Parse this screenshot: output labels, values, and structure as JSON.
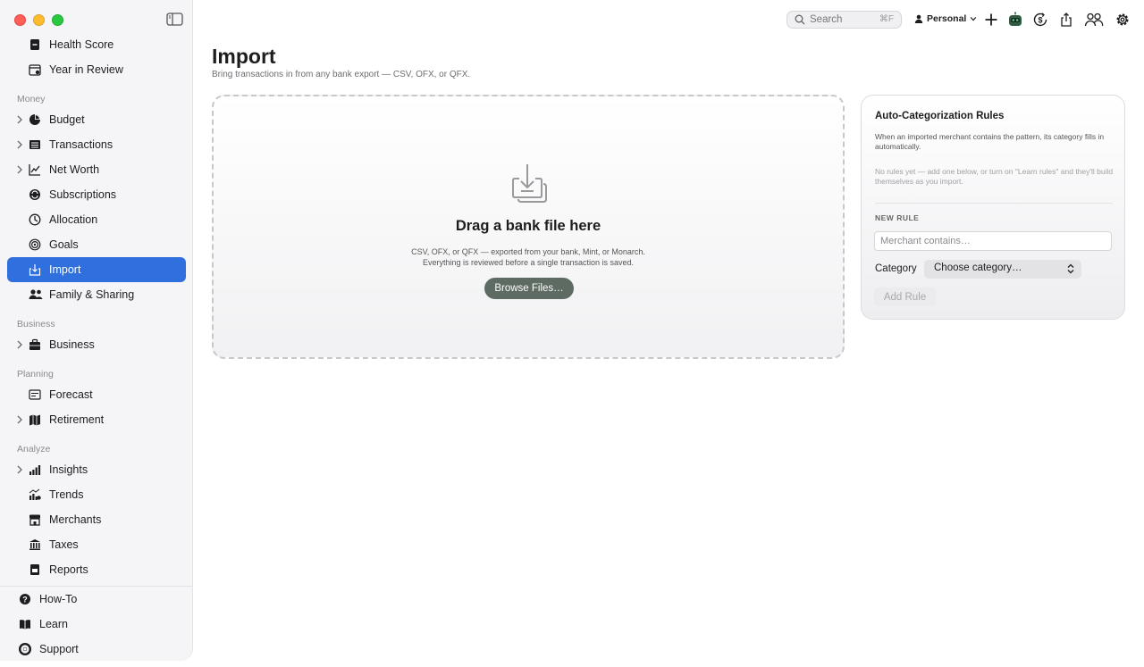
{
  "sidebar": {
    "top_items": [
      {
        "label": "Health Score"
      },
      {
        "label": "Year in Review"
      }
    ],
    "sections": [
      {
        "label": "Money",
        "items": [
          {
            "label": "Budget"
          },
          {
            "label": "Transactions"
          },
          {
            "label": "Net Worth"
          },
          {
            "label": "Subscriptions"
          },
          {
            "label": "Allocation"
          },
          {
            "label": "Goals"
          },
          {
            "label": "Import"
          },
          {
            "label": "Family & Sharing"
          }
        ]
      },
      {
        "label": "Business",
        "items": [
          {
            "label": "Business"
          }
        ]
      },
      {
        "label": "Planning",
        "items": [
          {
            "label": "Forecast"
          },
          {
            "label": "Retirement"
          }
        ]
      },
      {
        "label": "Analyze",
        "items": [
          {
            "label": "Insights"
          },
          {
            "label": "Trends"
          },
          {
            "label": "Merchants"
          },
          {
            "label": "Taxes"
          },
          {
            "label": "Reports"
          }
        ]
      }
    ],
    "footer": [
      {
        "label": "How-To"
      },
      {
        "label": "Learn"
      },
      {
        "label": "Support"
      }
    ]
  },
  "toolbar": {
    "search_placeholder": "Search",
    "search_shortcut": "⌘F",
    "profile": "Personal"
  },
  "page": {
    "title": "Import",
    "subtitle": "Bring transactions in from any bank export — CSV, OFX, or QFX."
  },
  "dropzone": {
    "title": "Drag a bank file here",
    "desc_line1": "CSV, OFX, or QFX — exported from your bank, Mint, or Monarch.",
    "desc_line2": "Everything is reviewed before a single transaction is saved.",
    "button": "Browse Files…"
  },
  "rules": {
    "title": "Auto-Categorization Rules",
    "description": "When an imported merchant contains the pattern, its category fills in automatically.",
    "empty": "No rules yet — add one below, or turn on \"Learn rules\" and they'll build themselves as you import.",
    "new_rule": "NEW RULE",
    "merchant_placeholder": "Merchant contains…",
    "category_label": "Category",
    "category_value": "Choose category…",
    "add_button": "Add Rule"
  },
  "colors": {
    "accent": "#2f6fde",
    "browse_button": "#5d6b62"
  }
}
